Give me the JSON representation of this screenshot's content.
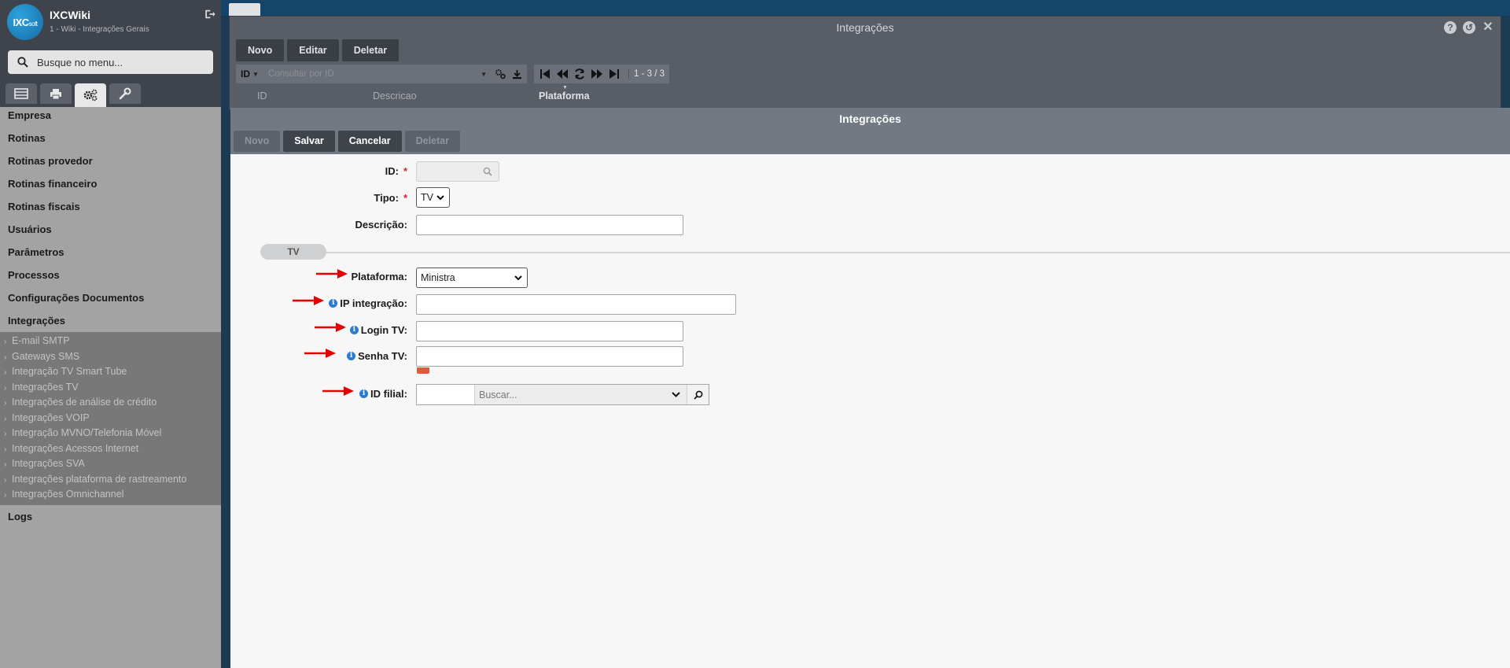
{
  "sidebar": {
    "app_title": "IXCWiki",
    "app_subtitle": "1 - Wiki - Integrações Gerais",
    "logo_text": "IXC",
    "logo_suffix": "soft",
    "search_placeholder": "Busque no menu...",
    "menu": [
      "Empresa",
      "Rotinas",
      "Rotinas provedor",
      "Rotinas financeiro",
      "Rotinas fiscais",
      "Usuários",
      "Parâmetros",
      "Processos",
      "Configurações Documentos",
      "Integrações"
    ],
    "submenu": [
      "E-mail SMTP",
      "Gateways SMS",
      "Integração TV Smart Tube",
      "Integrações TV",
      "Integrações de análise de crédito",
      "Integrações VOIP",
      "Integração MVNO/Telefonia Móvel",
      "Integrações Acessos Internet",
      "Integrações SVA",
      "Integrações plataforma de rastreamento",
      "Integrações Omnichannel"
    ],
    "logs": "Logs"
  },
  "background_window": {
    "title": "Integrações",
    "buttons": [
      "Novo",
      "Editar",
      "Deletar"
    ],
    "filter_field": "ID",
    "filter_placeholder": "Consultar por ID",
    "pager_count": "1 - 3 / 3",
    "columns": [
      "ID",
      "Descricao",
      "Plataforma"
    ]
  },
  "dialog": {
    "title": "Integrações",
    "buttons": {
      "novo": "Novo",
      "salvar": "Salvar",
      "cancelar": "Cancelar",
      "deletar": "Deletar"
    },
    "fields": {
      "id_label": "ID:",
      "tipo_label": "Tipo:",
      "tipo_value": "TV",
      "descricao_label": "Descrição:",
      "section": "TV",
      "plataforma_label": "Plataforma:",
      "plataforma_value": "Ministra",
      "ip_label": "IP integração:",
      "login_label": "Login TV:",
      "senha_label": "Senha TV:",
      "filial_label": "ID filial:",
      "filial_placeholder": "Buscar..."
    }
  },
  "colors": {
    "arrow": "#e60000",
    "required": "#d22222",
    "info": "#2a7bd1"
  }
}
